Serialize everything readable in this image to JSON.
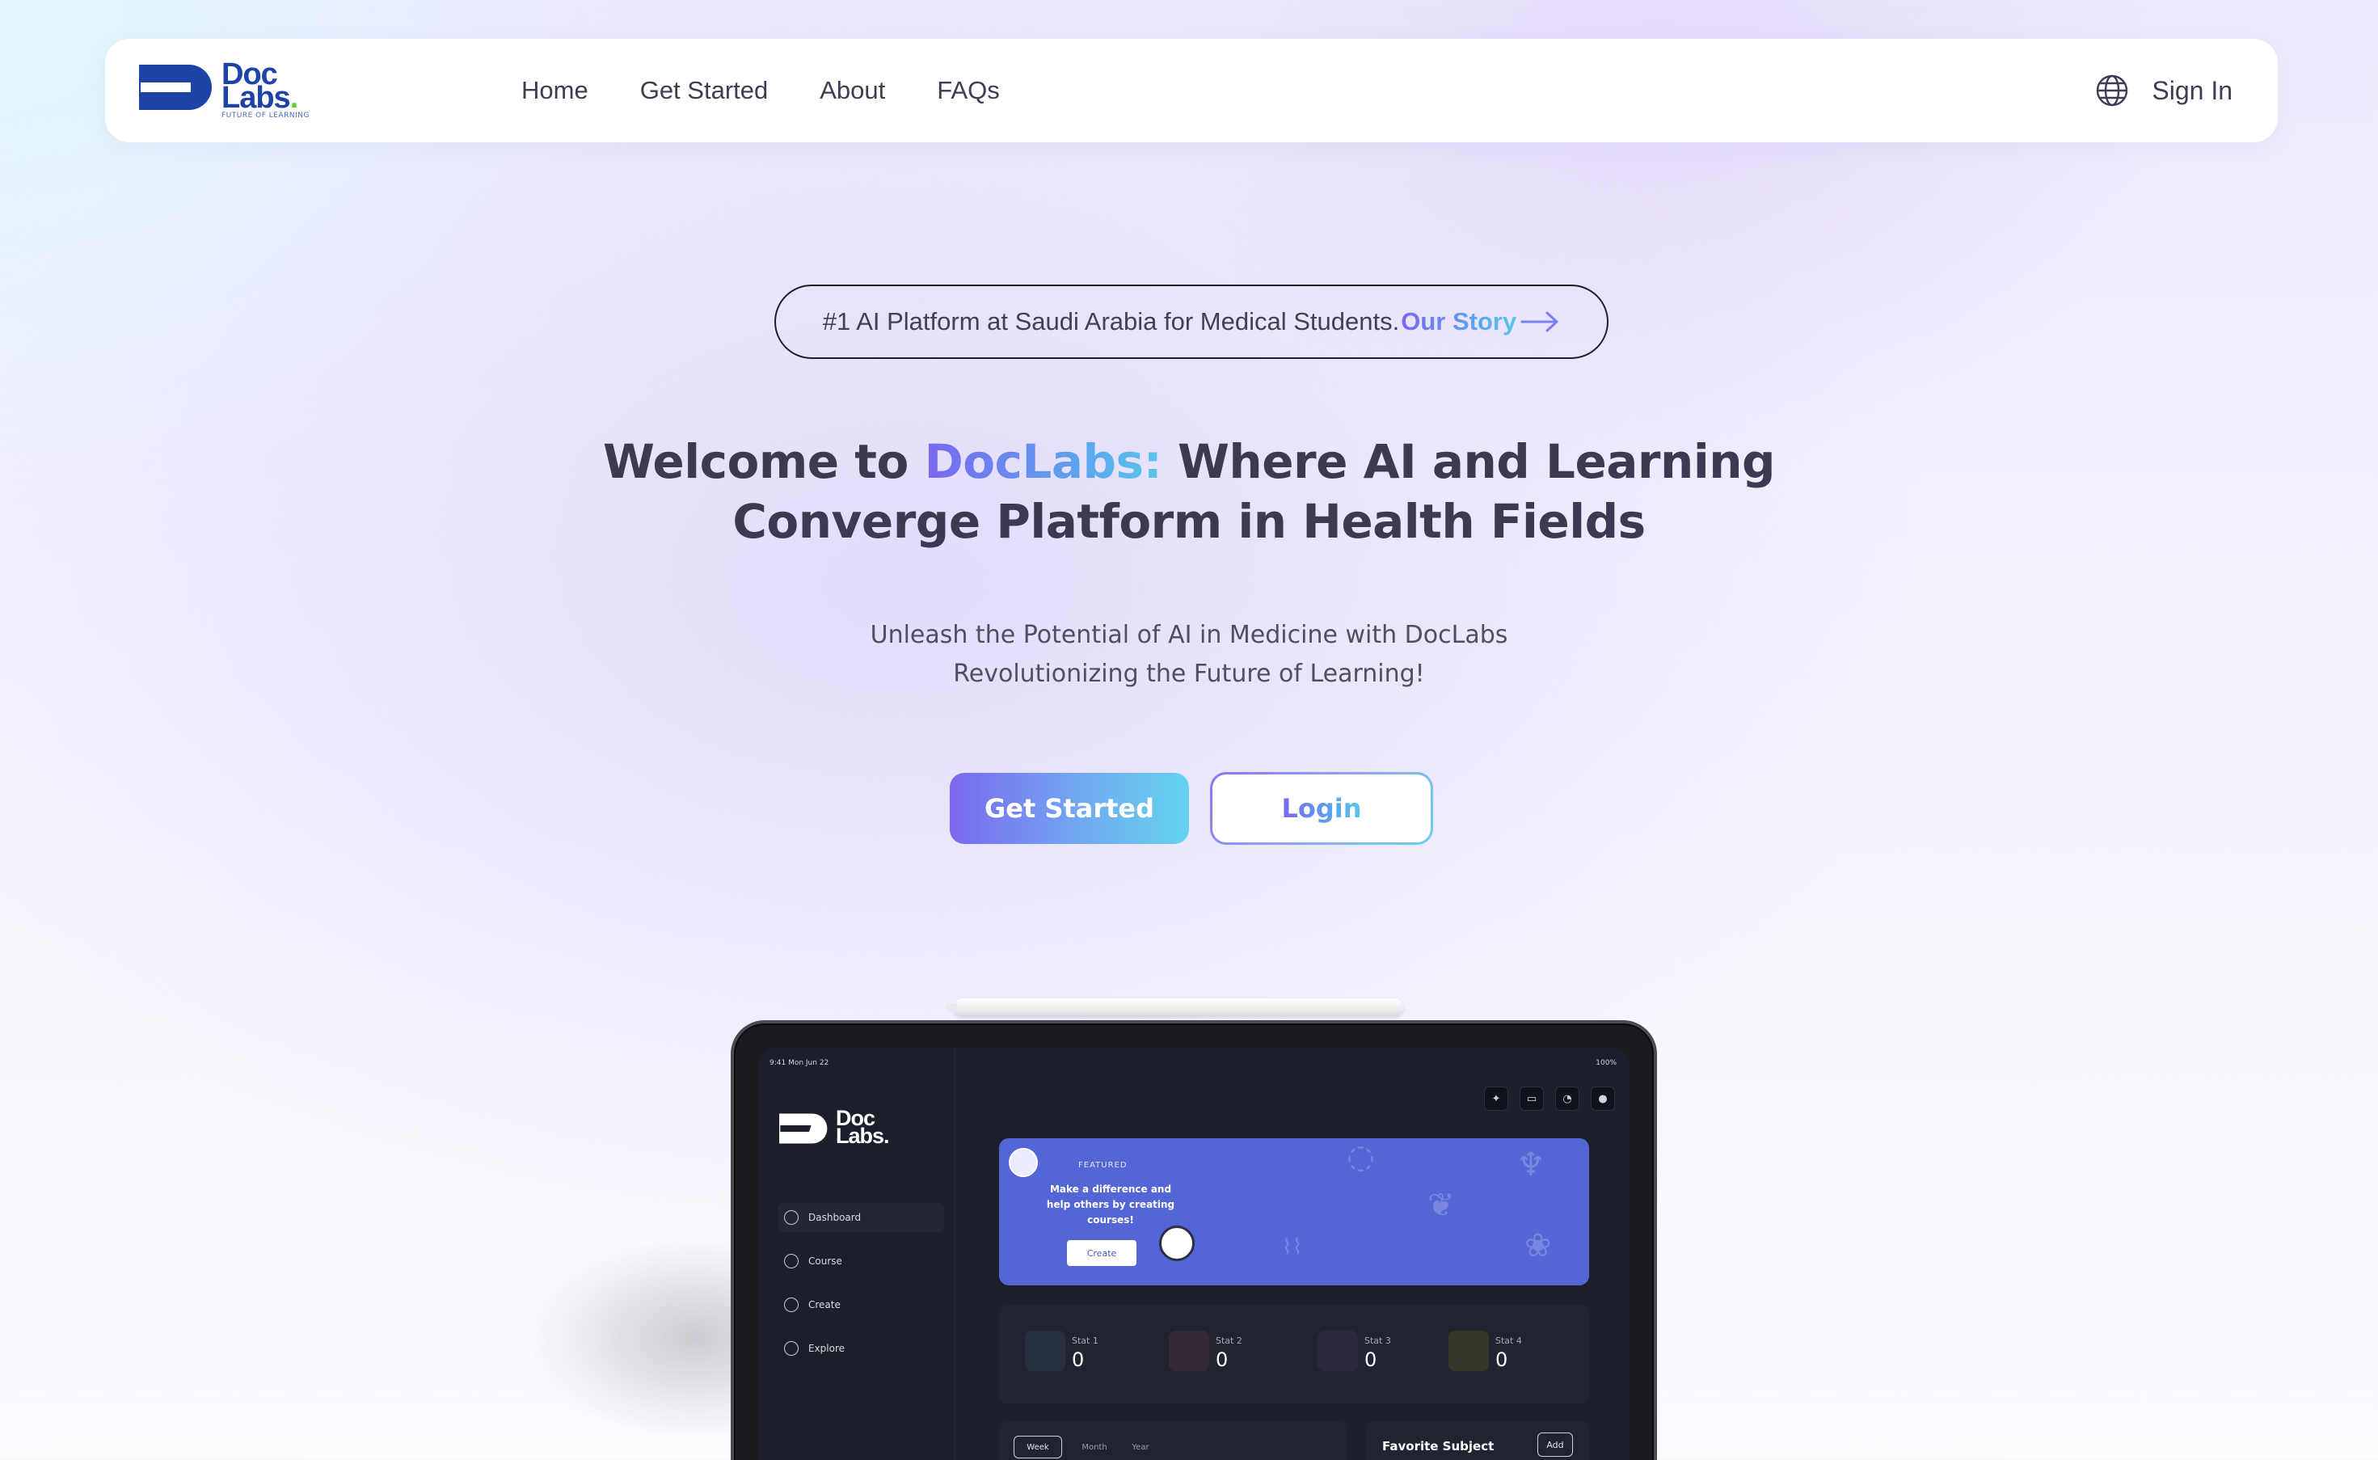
{
  "brand": {
    "logo_line1": "Doc",
    "logo_line2": "Labs",
    "logo_dot": ".",
    "logo_tagline": "FUTURE OF LEARNING"
  },
  "nav": {
    "links": [
      {
        "label": "Home"
      },
      {
        "label": "Get Started"
      },
      {
        "label": "About"
      },
      {
        "label": "FAQs"
      }
    ],
    "language_icon": "globe-icon",
    "signin_label": "Sign In"
  },
  "badge": {
    "text": "#1 AI Platform at Saudi Arabia for Medical Students.",
    "link_label": "Our Story",
    "link_icon": "arrow-right-icon"
  },
  "hero": {
    "title_prefix": "Welcome to ",
    "title_brand": "DocLabs:",
    "title_rest_line1": " Where AI and Learning",
    "title_line2": "Converge Platform in Health Fields",
    "subtitle_line1": "Unleash the Potential of AI in Medicine with DocLabs",
    "subtitle_line2": "Revolutionizing the Future of Learning!",
    "primary_button": "Get Started",
    "secondary_button": "Login"
  },
  "colors": {
    "brand_blue": "#1e43a8",
    "brand_green": "#5ed13a",
    "gradient_start": "#7a69ef",
    "gradient_end": "#63d3ee",
    "text_dark": "#3b3a52"
  },
  "device_preview": {
    "status_time": "9:41  Mon Jun 22",
    "status_battery": "100%",
    "app_logo_line1": "Doc",
    "app_logo_line2": "Labs.",
    "sidebar": [
      {
        "label": "Dashboard",
        "active": true
      },
      {
        "label": "Course",
        "active": false
      },
      {
        "label": "Create",
        "active": false
      },
      {
        "label": "Explore",
        "active": false
      }
    ],
    "top_icons": [
      "sparkle-icon",
      "chat-icon",
      "bell-icon",
      "user-icon"
    ],
    "featured": {
      "label": "FEATURED",
      "text": "Make a difference and help others by creating courses!",
      "button": "Create"
    },
    "stats": [
      {
        "label": "Stat 1",
        "value": "0",
        "color": "#26303f"
      },
      {
        "label": "Stat 2",
        "value": "0",
        "color": "#332a36"
      },
      {
        "label": "Stat 3",
        "value": "0",
        "color": "#2a2a3c"
      },
      {
        "label": "Stat 4",
        "value": "0",
        "color": "#35352a"
      }
    ],
    "range_tabs": [
      "Week",
      "Month",
      "Year"
    ],
    "favorite_title": "Favorite Subject",
    "favorite_add": "Add"
  }
}
